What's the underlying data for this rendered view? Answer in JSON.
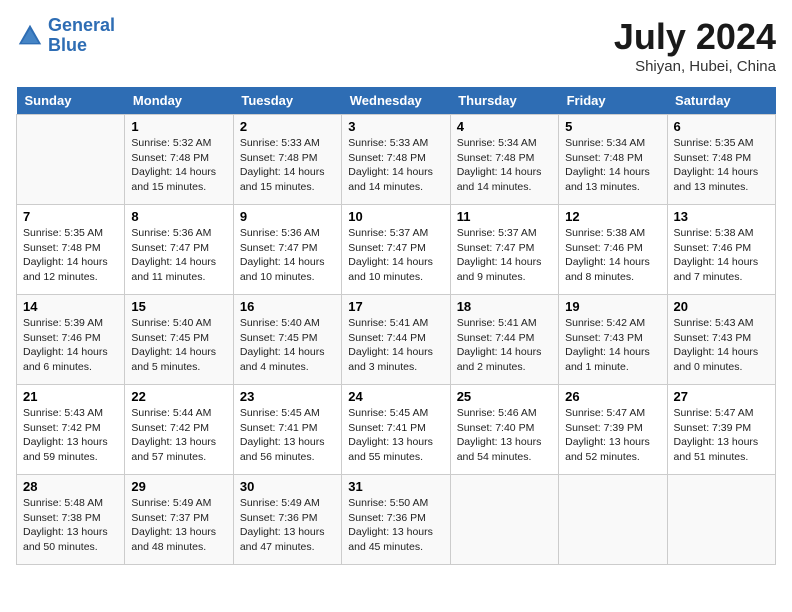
{
  "header": {
    "logo_line1": "General",
    "logo_line2": "Blue",
    "month": "July 2024",
    "location": "Shiyan, Hubei, China"
  },
  "weekdays": [
    "Sunday",
    "Monday",
    "Tuesday",
    "Wednesday",
    "Thursday",
    "Friday",
    "Saturday"
  ],
  "weeks": [
    [
      {
        "day": "",
        "info": ""
      },
      {
        "day": "1",
        "info": "Sunrise: 5:32 AM\nSunset: 7:48 PM\nDaylight: 14 hours\nand 15 minutes."
      },
      {
        "day": "2",
        "info": "Sunrise: 5:33 AM\nSunset: 7:48 PM\nDaylight: 14 hours\nand 15 minutes."
      },
      {
        "day": "3",
        "info": "Sunrise: 5:33 AM\nSunset: 7:48 PM\nDaylight: 14 hours\nand 14 minutes."
      },
      {
        "day": "4",
        "info": "Sunrise: 5:34 AM\nSunset: 7:48 PM\nDaylight: 14 hours\nand 14 minutes."
      },
      {
        "day": "5",
        "info": "Sunrise: 5:34 AM\nSunset: 7:48 PM\nDaylight: 14 hours\nand 13 minutes."
      },
      {
        "day": "6",
        "info": "Sunrise: 5:35 AM\nSunset: 7:48 PM\nDaylight: 14 hours\nand 13 minutes."
      }
    ],
    [
      {
        "day": "7",
        "info": "Sunrise: 5:35 AM\nSunset: 7:48 PM\nDaylight: 14 hours\nand 12 minutes."
      },
      {
        "day": "8",
        "info": "Sunrise: 5:36 AM\nSunset: 7:47 PM\nDaylight: 14 hours\nand 11 minutes."
      },
      {
        "day": "9",
        "info": "Sunrise: 5:36 AM\nSunset: 7:47 PM\nDaylight: 14 hours\nand 10 minutes."
      },
      {
        "day": "10",
        "info": "Sunrise: 5:37 AM\nSunset: 7:47 PM\nDaylight: 14 hours\nand 10 minutes."
      },
      {
        "day": "11",
        "info": "Sunrise: 5:37 AM\nSunset: 7:47 PM\nDaylight: 14 hours\nand 9 minutes."
      },
      {
        "day": "12",
        "info": "Sunrise: 5:38 AM\nSunset: 7:46 PM\nDaylight: 14 hours\nand 8 minutes."
      },
      {
        "day": "13",
        "info": "Sunrise: 5:38 AM\nSunset: 7:46 PM\nDaylight: 14 hours\nand 7 minutes."
      }
    ],
    [
      {
        "day": "14",
        "info": "Sunrise: 5:39 AM\nSunset: 7:46 PM\nDaylight: 14 hours\nand 6 minutes."
      },
      {
        "day": "15",
        "info": "Sunrise: 5:40 AM\nSunset: 7:45 PM\nDaylight: 14 hours\nand 5 minutes."
      },
      {
        "day": "16",
        "info": "Sunrise: 5:40 AM\nSunset: 7:45 PM\nDaylight: 14 hours\nand 4 minutes."
      },
      {
        "day": "17",
        "info": "Sunrise: 5:41 AM\nSunset: 7:44 PM\nDaylight: 14 hours\nand 3 minutes."
      },
      {
        "day": "18",
        "info": "Sunrise: 5:41 AM\nSunset: 7:44 PM\nDaylight: 14 hours\nand 2 minutes."
      },
      {
        "day": "19",
        "info": "Sunrise: 5:42 AM\nSunset: 7:43 PM\nDaylight: 14 hours\nand 1 minute."
      },
      {
        "day": "20",
        "info": "Sunrise: 5:43 AM\nSunset: 7:43 PM\nDaylight: 14 hours\nand 0 minutes."
      }
    ],
    [
      {
        "day": "21",
        "info": "Sunrise: 5:43 AM\nSunset: 7:42 PM\nDaylight: 13 hours\nand 59 minutes."
      },
      {
        "day": "22",
        "info": "Sunrise: 5:44 AM\nSunset: 7:42 PM\nDaylight: 13 hours\nand 57 minutes."
      },
      {
        "day": "23",
        "info": "Sunrise: 5:45 AM\nSunset: 7:41 PM\nDaylight: 13 hours\nand 56 minutes."
      },
      {
        "day": "24",
        "info": "Sunrise: 5:45 AM\nSunset: 7:41 PM\nDaylight: 13 hours\nand 55 minutes."
      },
      {
        "day": "25",
        "info": "Sunrise: 5:46 AM\nSunset: 7:40 PM\nDaylight: 13 hours\nand 54 minutes."
      },
      {
        "day": "26",
        "info": "Sunrise: 5:47 AM\nSunset: 7:39 PM\nDaylight: 13 hours\nand 52 minutes."
      },
      {
        "day": "27",
        "info": "Sunrise: 5:47 AM\nSunset: 7:39 PM\nDaylight: 13 hours\nand 51 minutes."
      }
    ],
    [
      {
        "day": "28",
        "info": "Sunrise: 5:48 AM\nSunset: 7:38 PM\nDaylight: 13 hours\nand 50 minutes."
      },
      {
        "day": "29",
        "info": "Sunrise: 5:49 AM\nSunset: 7:37 PM\nDaylight: 13 hours\nand 48 minutes."
      },
      {
        "day": "30",
        "info": "Sunrise: 5:49 AM\nSunset: 7:36 PM\nDaylight: 13 hours\nand 47 minutes."
      },
      {
        "day": "31",
        "info": "Sunrise: 5:50 AM\nSunset: 7:36 PM\nDaylight: 13 hours\nand 45 minutes."
      },
      {
        "day": "",
        "info": ""
      },
      {
        "day": "",
        "info": ""
      },
      {
        "day": "",
        "info": ""
      }
    ]
  ]
}
